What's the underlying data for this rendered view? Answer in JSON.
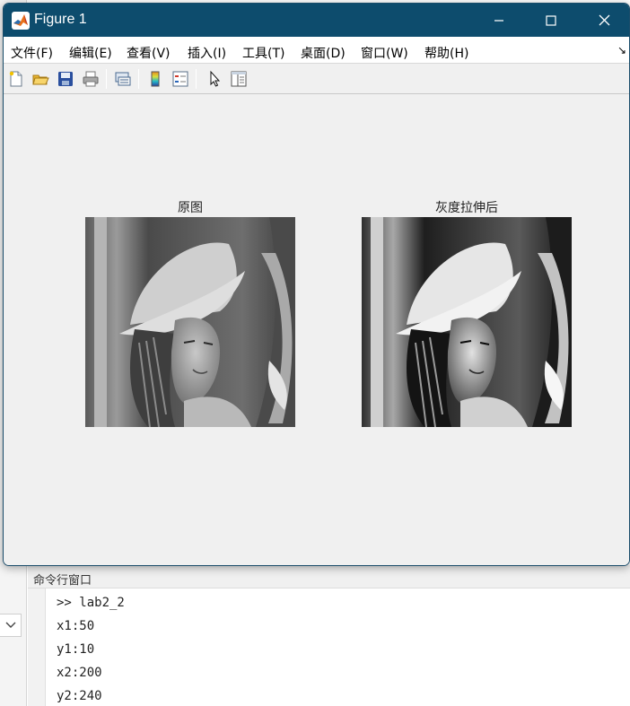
{
  "window": {
    "title": "Figure 1",
    "controls": [
      "minimize",
      "maximize",
      "close"
    ]
  },
  "menubar": {
    "items": [
      {
        "label": "文件(F)"
      },
      {
        "label": "编辑(E)"
      },
      {
        "label": "查看(V)"
      },
      {
        "label": "插入(I)"
      },
      {
        "label": "工具(T)"
      },
      {
        "label": "桌面(D)"
      },
      {
        "label": "窗口(W)"
      },
      {
        "label": "帮助(H)"
      }
    ],
    "overflow_icon": "dock-arrow-icon"
  },
  "toolbar": {
    "buttons": [
      {
        "icon": "new-figure-icon"
      },
      {
        "icon": "open-file-icon"
      },
      {
        "icon": "save-icon"
      },
      {
        "icon": "print-icon"
      },
      {
        "icon": "link-plot-icon"
      },
      {
        "icon": "colorbar-icon"
      },
      {
        "icon": "legend-icon"
      },
      {
        "icon": "edit-plot-pointer-icon"
      },
      {
        "icon": "property-inspector-icon"
      }
    ]
  },
  "figure": {
    "axes": [
      {
        "title": "原图",
        "content": "grayscale photograph (original)"
      },
      {
        "title": "灰度拉伸后",
        "content": "grayscale photograph (contrast stretched)"
      }
    ]
  },
  "command_window": {
    "title": "命令行窗口",
    "lines": [
      ">> lab2_2",
      "x1:50",
      "y1:10",
      "x2:200",
      "y2:240"
    ]
  },
  "colors": {
    "titlebar": "#0d4c6d",
    "canvas": "#f0f0f0",
    "menubar": "#ffffff"
  }
}
